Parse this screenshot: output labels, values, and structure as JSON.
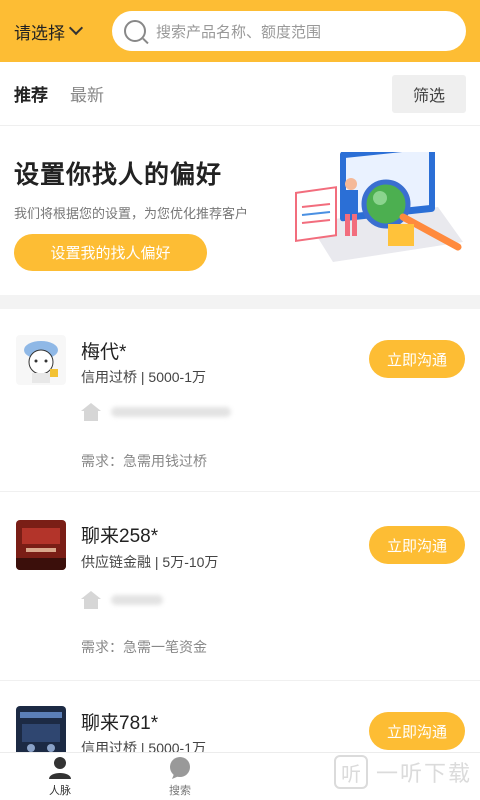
{
  "header": {
    "select_label": "请选择",
    "search_placeholder": "搜索产品名称、额度范围"
  },
  "tabs": [
    {
      "label": "推荐",
      "active": true
    },
    {
      "label": "最新",
      "active": false
    }
  ],
  "filter_label": "筛选",
  "banner": {
    "title": "设置你找人的偏好",
    "subtitle": "我们将根据您的设置，为您优化推荐客户",
    "button_label": "设置我的找人偏好"
  },
  "list": [
    {
      "name": "梅代*",
      "meta": "信用过桥 | 5000-1万",
      "need": "需求：急需用钱过桥",
      "button": "立即沟通"
    },
    {
      "name": "聊来258*",
      "meta": "供应链金融 | 5万-10万",
      "need": "需求：急需一笔资金",
      "button": "立即沟通"
    },
    {
      "name": "聊来781*",
      "meta": "信用过桥 | 5000-1万",
      "need": "",
      "button": "立即沟通"
    }
  ],
  "bottom_nav": [
    {
      "label": "人脉",
      "icon": "person-icon"
    },
    {
      "label": "搜索",
      "icon": "chat-bubble-icon"
    }
  ],
  "watermark": {
    "text": "一听下载"
  },
  "colors": {
    "accent": "#fdbd34",
    "background": "#ffffff"
  }
}
